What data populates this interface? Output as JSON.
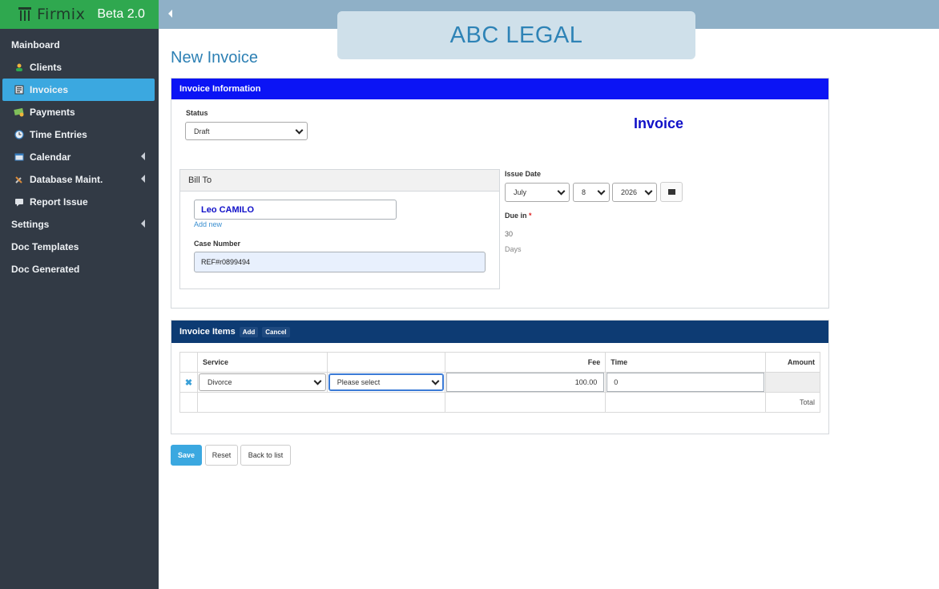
{
  "sidebar": {
    "brand": "Firmix",
    "version": "Beta 2.0",
    "items": [
      {
        "label": "Mainboard"
      },
      {
        "label": "Clients"
      },
      {
        "label": "Invoices"
      },
      {
        "label": "Payments"
      },
      {
        "label": "Time Entries"
      },
      {
        "label": "Calendar"
      },
      {
        "label": "Database Maint."
      },
      {
        "label": "Report Issue"
      },
      {
        "label": "Settings"
      },
      {
        "label": "Doc Templates"
      },
      {
        "label": "Doc Generated"
      }
    ]
  },
  "header": {
    "company": "ABC LEGAL"
  },
  "page": {
    "title": "New Invoice"
  },
  "invoice_info": {
    "heading": "Invoice Information",
    "status_label": "Status",
    "status_value": "Draft",
    "invoice_word": "Invoice",
    "bill_to": {
      "heading": "Bill To",
      "client": "Leo CAMILO",
      "add_new": "Add new",
      "case_label": "Case Number",
      "case_value": "REF#r0899494"
    },
    "issue_date_label": "Issue Date",
    "issue_month": "July",
    "issue_day": "8",
    "issue_year": "2026",
    "due_label": "Due in",
    "due_required": "*",
    "due_value": "30",
    "due_unit": "Days"
  },
  "items": {
    "heading": "Invoice Items",
    "add_label": "Add",
    "cancel_label": "Cancel",
    "columns": {
      "service": "Service",
      "blank": "",
      "fee": "Fee",
      "time": "Time",
      "amount": "Amount"
    },
    "row": {
      "remove": "✖",
      "service": "Divorce",
      "sub_service": "Please select",
      "fee": "100.00",
      "time": "0",
      "amount": ""
    },
    "total_label": "Total"
  },
  "actions": {
    "save": "Save",
    "reset": "Reset",
    "back": "Back to list"
  },
  "colors": {
    "sidebar": "#323a45",
    "brand": "#2fa84f",
    "active": "#3ba8e0",
    "info_header": "#0b14f5",
    "items_header": "#0d3b73",
    "title": "#2d80b4"
  }
}
